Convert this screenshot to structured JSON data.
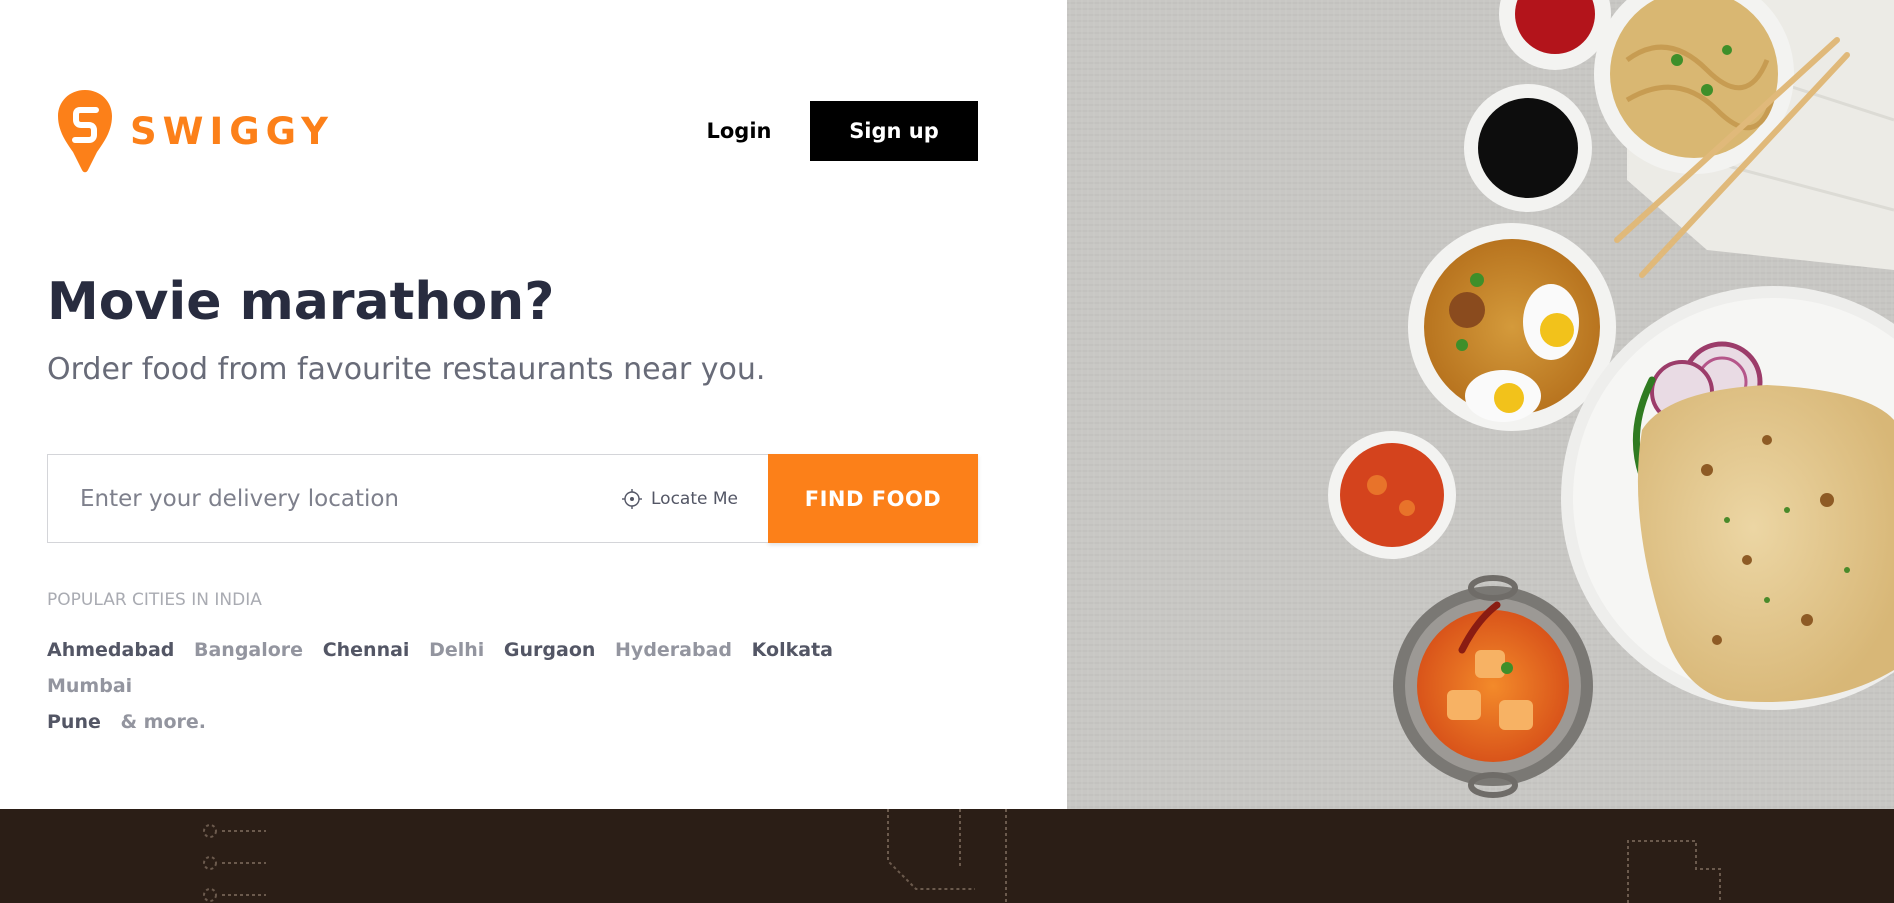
{
  "brand": {
    "name": "SWIGGY",
    "accent_color": "#fc8019",
    "logo_icon": "swiggy-pin-logo"
  },
  "header": {
    "login_label": "Login",
    "signup_label": "Sign up"
  },
  "hero": {
    "headline": "Movie marathon?",
    "subline": "Order food from favourite restaurants near you."
  },
  "search": {
    "placeholder": "Enter your delivery location",
    "value": "",
    "locate_label": "Locate Me",
    "locate_icon": "crosshair-icon",
    "submit_label": "FIND FOOD"
  },
  "popular": {
    "title": "POPULAR CITIES IN INDIA",
    "cities": [
      "Ahmedabad",
      "Bangalore",
      "Chennai",
      "Delhi",
      "Gurgaon",
      "Hyderabad",
      "Kolkata",
      "Mumbai",
      "Pune"
    ],
    "more_label": "& more."
  },
  "colors": {
    "text_dark": "#282c3f",
    "text_grey": "#686b78",
    "button_black": "#000000",
    "footer_band": "#2b1e16"
  }
}
